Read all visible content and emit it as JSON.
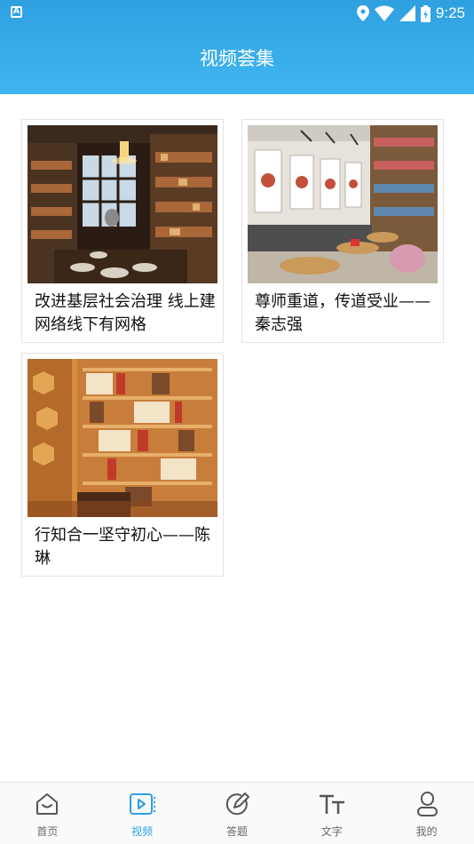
{
  "status_bar": {
    "time": "9:25",
    "app_badge": "A"
  },
  "header": {
    "title": "视频荟集"
  },
  "videos": [
    {
      "caption": "改进基层社会治理 线上建网络线下有网格",
      "thumbnail": "dark-bookstore-interior"
    },
    {
      "caption": "尊师重道，传道受业——秦志强",
      "thumbnail": "cafe-bookstore-portraits"
    },
    {
      "caption": "行知合一坚守初心——陈琳",
      "thumbnail": "warm-bookshelves"
    }
  ],
  "tabs": [
    {
      "label": "首页",
      "icon": "home-icon",
      "active": false
    },
    {
      "label": "视频",
      "icon": "video-icon",
      "active": true
    },
    {
      "label": "答题",
      "icon": "edit-icon",
      "active": false
    },
    {
      "label": "文字",
      "icon": "text-icon",
      "active": false
    },
    {
      "label": "我的",
      "icon": "user-icon",
      "active": false
    }
  ],
  "colors": {
    "accent": "#2aa0e4",
    "header_top": "#2fa0e0",
    "header_bottom": "#40b6f0",
    "tab_inactive": "#666666"
  }
}
